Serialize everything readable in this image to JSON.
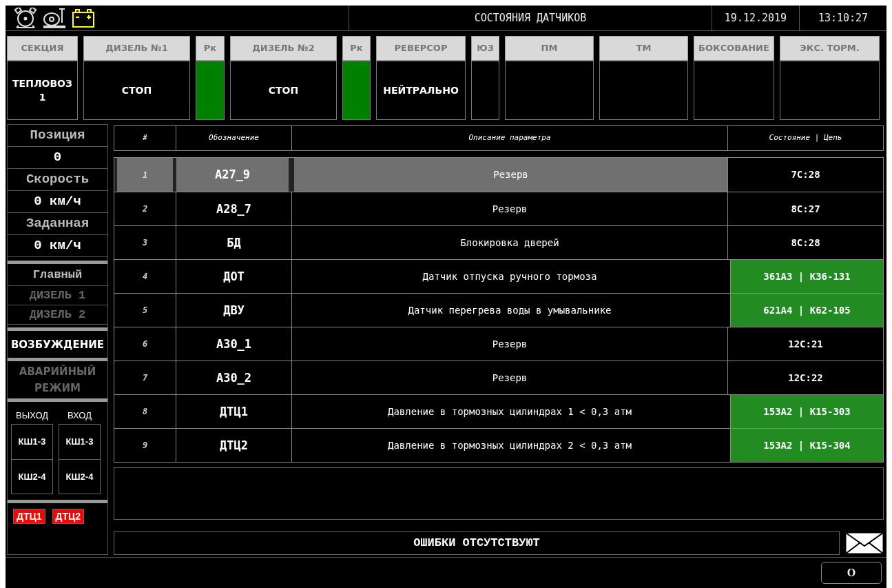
{
  "top_bar": {
    "title": "СОСТОЯНИЯ ДАТЧИКОВ",
    "date": "19.12.2019",
    "time": "13:10:27"
  },
  "tiles": [
    {
      "label": "СЕКЦИЯ",
      "kind": "text",
      "value": "ТЕПЛОВОЗ 1"
    },
    {
      "label": "ДИЗЕЛЬ №1",
      "kind": "text",
      "value": "СТОП"
    },
    {
      "label": "Рк",
      "kind": "indicator",
      "on": true
    },
    {
      "label": "ДИЗЕЛЬ №2",
      "kind": "text",
      "value": "СТОП"
    },
    {
      "label": "Рк",
      "kind": "indicator",
      "on": true
    },
    {
      "label": "РЕВЕРСОР",
      "kind": "text",
      "value": "НЕЙТРАЛЬНО"
    },
    {
      "label": "ЮЗ",
      "kind": "indicator",
      "on": false
    },
    {
      "label": "ПМ",
      "kind": "indicator",
      "on": false
    },
    {
      "label": "ТМ",
      "kind": "indicator",
      "on": false
    },
    {
      "label": "БОКСОВАНИЕ",
      "kind": "indicator",
      "on": false
    },
    {
      "label": "ЭКС. ТОРМ.",
      "kind": "indicator",
      "on": false
    }
  ],
  "sidebar": {
    "readings": [
      {
        "label": "Позиция",
        "value": "0"
      },
      {
        "label": "Скорость",
        "value": "0 км/ч"
      },
      {
        "label": "Заданная",
        "value": "0 км/ч"
      }
    ],
    "main": {
      "label": "Главный",
      "diesels": [
        {
          "label": "ДИЗЕЛЬ 1",
          "active": false
        },
        {
          "label": "ДИЗЕЛЬ 2",
          "active": false
        }
      ]
    },
    "modes": [
      {
        "label": "ВОЗБУЖДЕНИЕ",
        "active": true
      },
      {
        "label": "АВАРИЙНЫЙ РЕЖИМ",
        "active": false
      }
    ],
    "connectors": [
      {
        "heading": "ВЫХОД",
        "items": [
          "КШ1-3",
          "КШ2-4"
        ]
      },
      {
        "heading": "ВХОД",
        "items": [
          "КШ1-3",
          "КШ2-4"
        ]
      }
    ],
    "alarms": [
      {
        "label": "ДТЦ1",
        "on": true
      },
      {
        "label": "ДТЦ2",
        "on": true
      }
    ]
  },
  "table": {
    "columns": [
      "#",
      "Обозначение",
      "Описание параметра",
      "Состояние | Цепь"
    ],
    "rows": [
      {
        "index": "1",
        "code": "А27_9",
        "description": "Резерв",
        "status": "7С:28",
        "active": false,
        "selected": true
      },
      {
        "index": "2",
        "code": "А28_7",
        "description": "Резерв",
        "status": "8С:27",
        "active": false,
        "selected": false
      },
      {
        "index": "3",
        "code": "БД",
        "description": "Блокировка дверей",
        "status": "8С:28",
        "active": false,
        "selected": false
      },
      {
        "index": "4",
        "code": "ДОТ",
        "description": "Датчик отпуска ручного тормоза",
        "status": "361А3 | К36-131",
        "active": true,
        "selected": false
      },
      {
        "index": "5",
        "code": "ДВУ",
        "description": "Датчик перегрева воды в умывальнике",
        "status": "621А4 | К62-105",
        "active": true,
        "selected": false
      },
      {
        "index": "6",
        "code": "А30_1",
        "description": "Резерв",
        "status": "12С:21",
        "active": false,
        "selected": false
      },
      {
        "index": "7",
        "code": "А30_2",
        "description": "Резерв",
        "status": "12С:22",
        "active": false,
        "selected": false
      },
      {
        "index": "8",
        "code": "ДТЦ1",
        "description": "Давление в тормозных цилиндрах 1 < 0,3 атм",
        "status": "153А2 | К15-303",
        "active": true,
        "selected": false
      },
      {
        "index": "9",
        "code": "ДТЦ2",
        "description": "Давление в тормозных цилиндрах 2 < 0,3 атм",
        "status": "153А2 | К15-304",
        "active": true,
        "selected": false
      }
    ]
  },
  "errors": {
    "message": "ОШИБКИ ОТСУТСТВУЮТ"
  },
  "bottom_bar": {
    "button": "О"
  }
}
